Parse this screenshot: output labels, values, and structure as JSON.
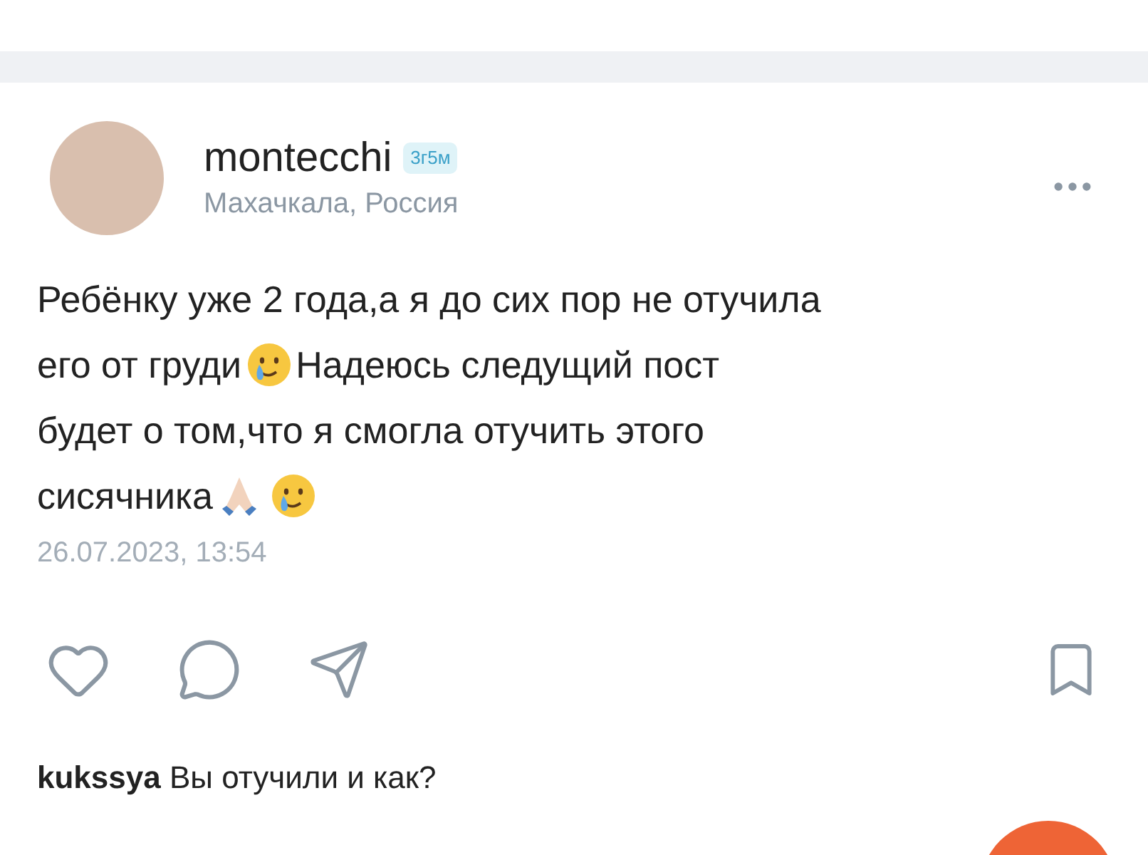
{
  "post": {
    "author": "montecchi",
    "age_badge": "3г5м",
    "location": "Махачкала, Россия",
    "body_lines": [
      [
        {
          "kind": "text",
          "text": "Ребёнку уже 2 года,а я до сих пор не отучила"
        }
      ],
      [
        {
          "kind": "text",
          "text": "его от груди"
        },
        {
          "kind": "crying"
        },
        {
          "kind": "text",
          "text": "Надеюсь следущий пост"
        }
      ],
      [
        {
          "kind": "text",
          "text": "будет о том,что я смогла отучить этого"
        }
      ],
      [
        {
          "kind": "text",
          "text": "сисячника"
        },
        {
          "kind": "praying"
        },
        {
          "kind": "crying"
        }
      ]
    ],
    "date": "26.07.2023, 13:54"
  },
  "comment": {
    "author": "kukssya",
    "text": "Вы отучили и как?"
  }
}
